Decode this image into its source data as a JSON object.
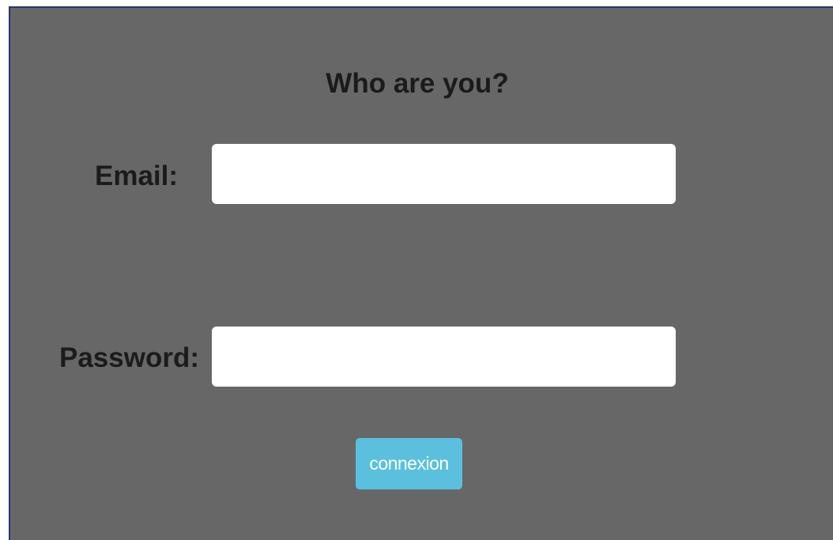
{
  "form": {
    "title": "Who are you?",
    "email_label": "Email:",
    "email_value": "",
    "password_label": "Password:",
    "password_value": "",
    "submit_label": "connexion"
  },
  "colors": {
    "panel_background": "#676767",
    "panel_border": "#27337a",
    "button_background": "#5bc0de",
    "label_text": "#1b1b1b"
  }
}
